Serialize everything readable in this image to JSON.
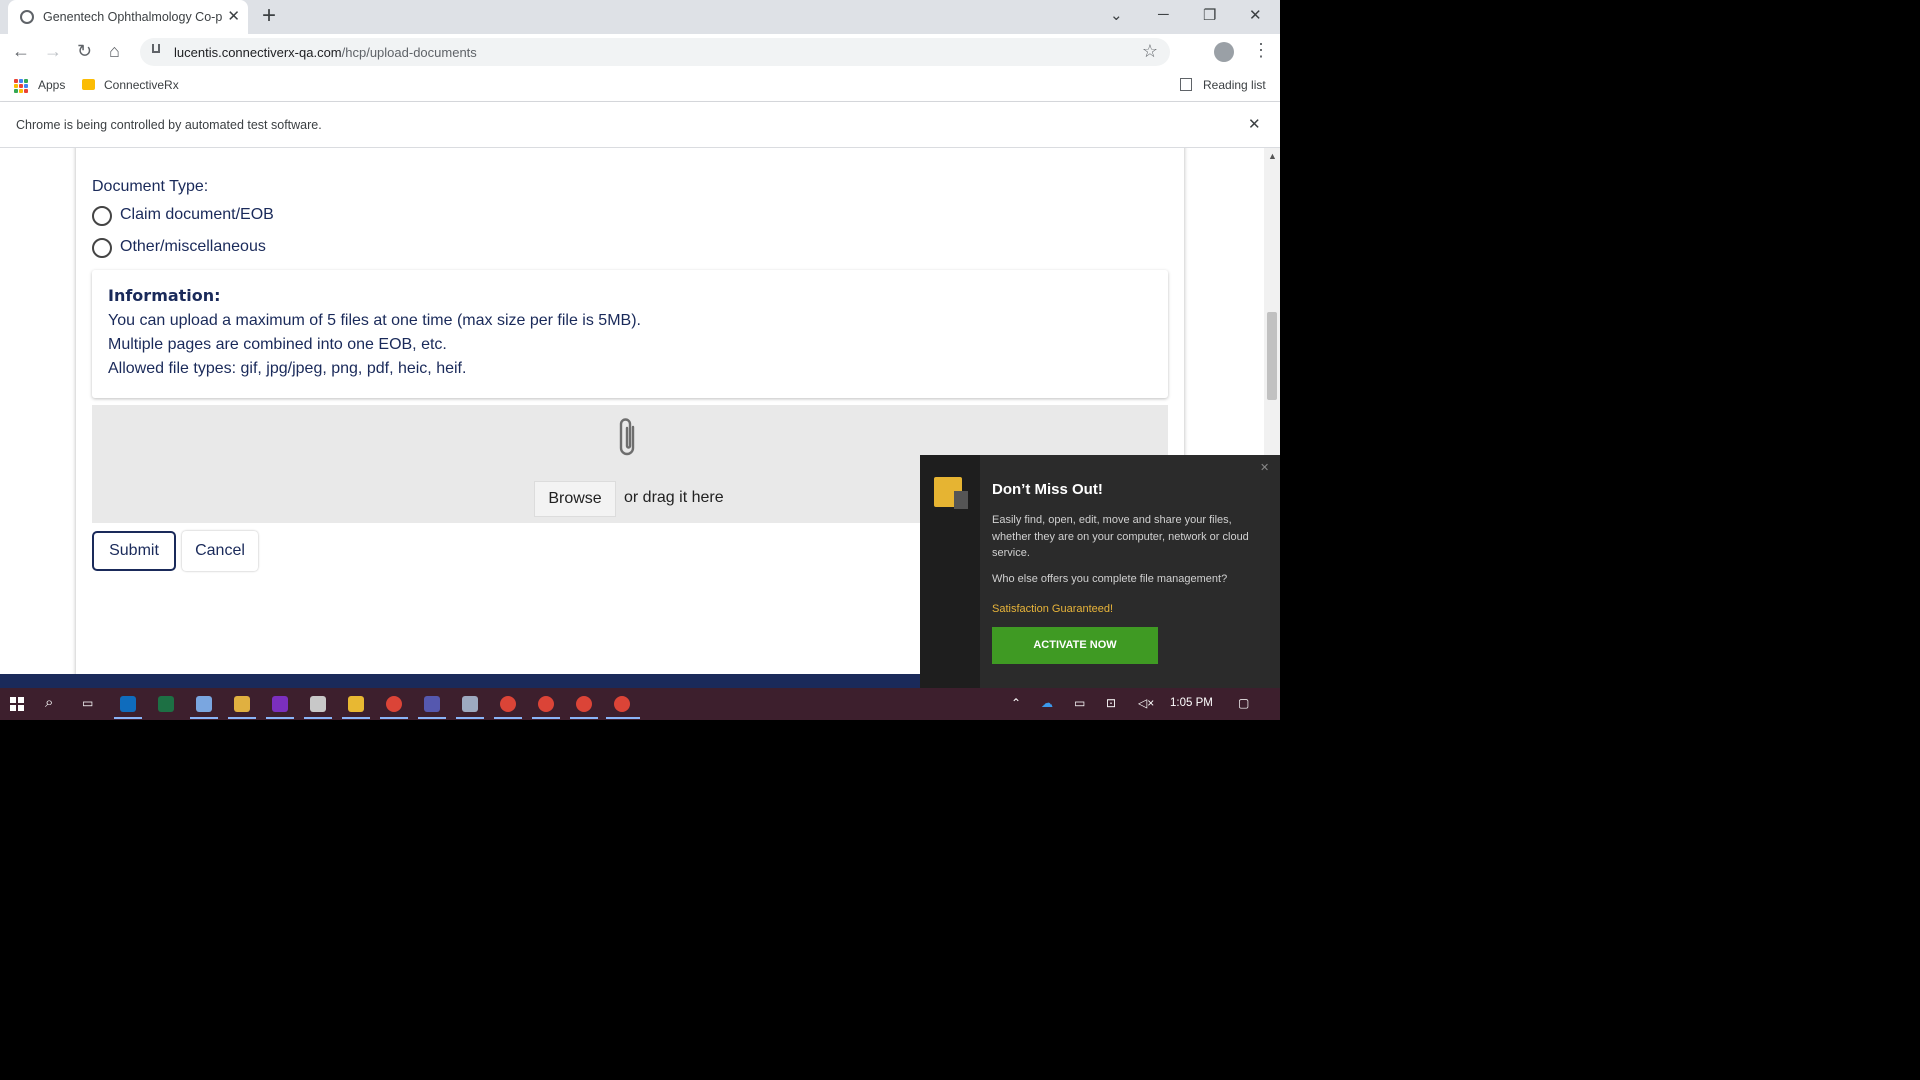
{
  "browser": {
    "tab_title": "Genentech Ophthalmology Co-p",
    "url_host": "lucentis.connectiverx-qa.com",
    "url_path": "/hcp/upload-documents",
    "bookmarks": [
      "Apps",
      "ConnectiveRx"
    ],
    "reading_list": "Reading list",
    "infobar_message": "Chrome is being controlled by automated test software."
  },
  "form": {
    "document_type_label": "Document Type:",
    "options": [
      "Claim document/EOB",
      "Other/miscellaneous"
    ],
    "info": {
      "heading": "Information:",
      "lines": [
        "You can upload a maximum of 5 files at one time (max size per file is 5MB).",
        "Multiple pages are combined into one EOB, etc.",
        "Allowed file types: gif, jpg/jpeg, png, pdf, heic, heif."
      ]
    },
    "browse_label": "Browse",
    "drag_text": "or drag it here",
    "submit_label": "Submit",
    "cancel_label": "Cancel"
  },
  "popup": {
    "title": "Don’t Miss Out!",
    "description": "Easily find, open, edit, move and share your files, whether they are on your computer, network or cloud service.",
    "question": "Who else offers you complete file management?",
    "guarantee": "Satisfaction Guaranteed!",
    "button": "ACTIVATE NOW"
  },
  "taskbar": {
    "clock": "1:05 PM"
  },
  "colors": {
    "brand_navy": "#1a2a5a",
    "activate_green": "#3f9a23",
    "guarantee_gold": "#e8b43a",
    "taskbar_bg": "#3d1f2d"
  }
}
